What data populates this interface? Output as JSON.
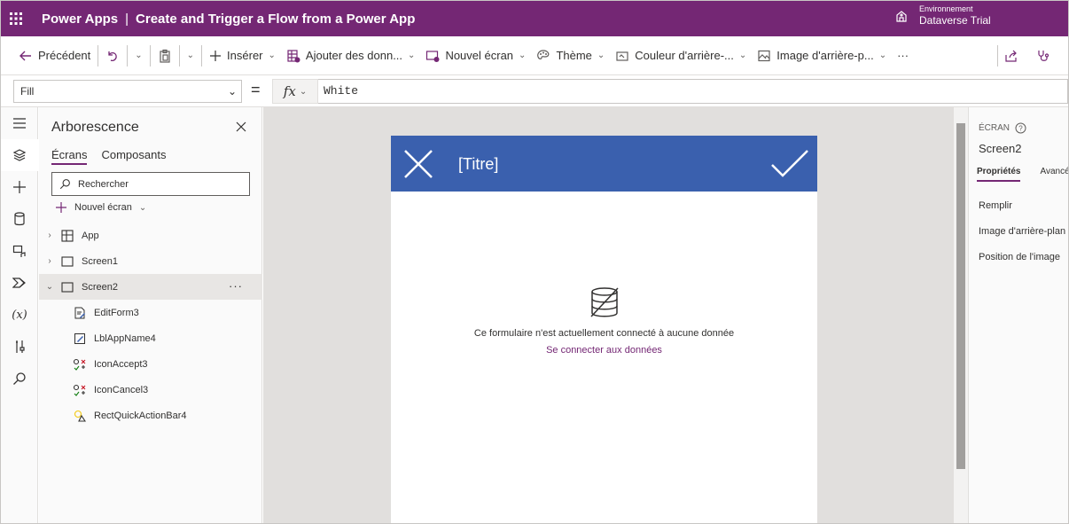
{
  "topbar": {
    "app_name": "Power Apps",
    "separator": "|",
    "doc_title": "Create and Trigger a Flow from a Power App",
    "env_label": "Environnement",
    "env_name": "Dataverse Trial"
  },
  "commands": {
    "back": "Précédent",
    "insert": "Insérer",
    "add_data": "Ajouter des donn...",
    "new_screen": "Nouvel écran",
    "theme": "Thème",
    "bg_color": "Couleur d'arrière-...",
    "bg_image": "Image d'arrière-p...",
    "more": "···"
  },
  "formula_bar": {
    "property": "Fill",
    "equals": "=",
    "fx": "fx",
    "formula": "White"
  },
  "tree": {
    "title": "Arborescence",
    "tabs": [
      "Écrans",
      "Composants"
    ],
    "search_placeholder": "Rechercher",
    "new_screen": "Nouvel écran",
    "nodes": [
      {
        "label": "App"
      },
      {
        "label": "Screen1"
      },
      {
        "label": "Screen2",
        "more": "···"
      }
    ],
    "children": [
      {
        "label": "EditForm3"
      },
      {
        "label": "LblAppName4"
      },
      {
        "label": "IconAccept3"
      },
      {
        "label": "IconCancel3"
      },
      {
        "label": "RectQuickActionBar4"
      }
    ]
  },
  "canvas": {
    "header_title": "[Titre]",
    "header_color": "#3a60ae",
    "empty_message": "Ce formulaire n'est actuellement connecté à aucune donnée",
    "connect_link": "Se connecter aux données"
  },
  "props": {
    "eyebrow": "ÉCRAN",
    "screen_name": "Screen2",
    "tabs": [
      "Propriétés",
      "Avancé"
    ],
    "rows": [
      "Remplir",
      "Image d'arrière-plan",
      "Position de l'image"
    ]
  },
  "colors": {
    "brand": "#742774",
    "header": "#3a60ae"
  }
}
